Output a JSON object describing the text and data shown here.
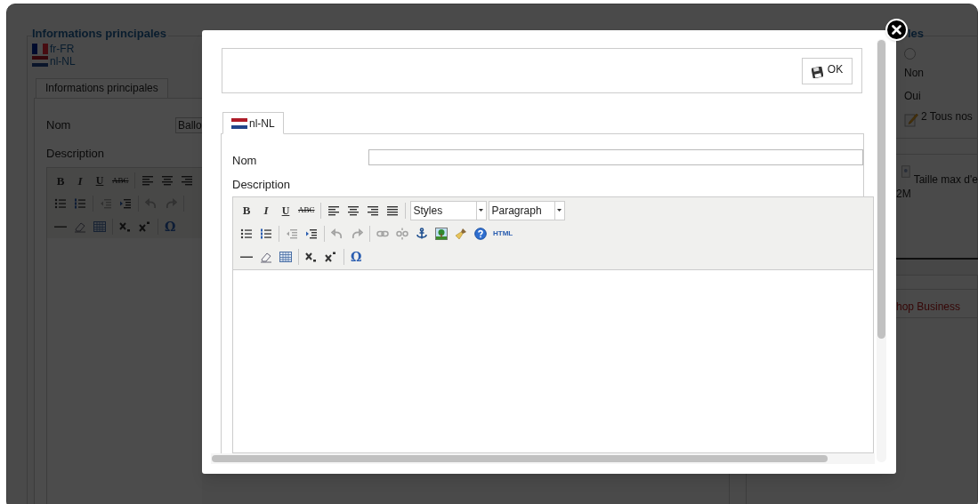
{
  "background_page": {
    "left_panel": {
      "heading": "Informations principales",
      "languages": [
        {
          "kind": "fr",
          "label": "fr-FR"
        },
        {
          "kind": "nl",
          "label": "nl-NL"
        }
      ],
      "tabs": [
        {
          "label": "Informations principales",
          "selected": true
        }
      ],
      "name_label": "Nom",
      "name_value": "Ballo",
      "description_label": "Description",
      "toolbar_rows": [
        [
          {
            "kind": "bold",
            "text": "B",
            "disabled": false
          },
          {
            "kind": "italic",
            "text": "I",
            "disabled": false
          },
          {
            "kind": "underline",
            "text": "U",
            "disabled": false
          },
          {
            "kind": "strike",
            "text": "ABC",
            "disabled": false
          },
          {
            "kind": "separator"
          },
          {
            "kind": "align-left",
            "disabled": false
          },
          {
            "kind": "align-center",
            "disabled": false
          },
          {
            "kind": "align-right",
            "disabled": false
          }
        ],
        [
          {
            "kind": "bullet-list",
            "disabled": false
          },
          {
            "kind": "number-list",
            "disabled": false
          },
          {
            "kind": "separator"
          },
          {
            "kind": "outdent",
            "disabled": true
          },
          {
            "kind": "indent",
            "disabled": false
          },
          {
            "kind": "separator"
          },
          {
            "kind": "undo",
            "disabled": true
          },
          {
            "kind": "redo",
            "disabled": true
          },
          {
            "kind": "separator"
          }
        ],
        [
          {
            "kind": "hr",
            "disabled": false
          },
          {
            "kind": "eraser",
            "disabled": false
          },
          {
            "kind": "table",
            "disabled": false
          },
          {
            "kind": "separator"
          },
          {
            "kind": "subscript",
            "disabled": false
          },
          {
            "kind": "superscript",
            "disabled": false
          },
          {
            "kind": "separator"
          },
          {
            "kind": "omega",
            "text": "Ω",
            "disabled": false
          }
        ]
      ]
    },
    "right_panel": {
      "heading": "les",
      "radio_checked": false,
      "options": [
        "Non",
        "Oui"
      ],
      "category_text": "2 Tous nos",
      "upload_text": "Taille max d'e",
      "upload_size": "2M",
      "link_text": "hop Business"
    }
  },
  "modal": {
    "ok_button": "OK",
    "tabs": [
      {
        "kind": "nl",
        "label": "nl-NL",
        "selected": true
      }
    ],
    "name_label": "Nom",
    "description_label": "Description",
    "styles_select": "Styles",
    "format_select": "Paragraph",
    "toolbar_rows": [
      [
        {
          "kind": "bold",
          "text": "B",
          "disabled": false
        },
        {
          "kind": "italic",
          "text": "I",
          "disabled": false
        },
        {
          "kind": "underline",
          "text": "U",
          "disabled": false
        },
        {
          "kind": "strike",
          "text": "ABC",
          "disabled": false
        },
        {
          "kind": "separator"
        },
        {
          "kind": "align-left",
          "disabled": false
        },
        {
          "kind": "align-center",
          "disabled": false
        },
        {
          "kind": "align-right",
          "disabled": false
        },
        {
          "kind": "justify",
          "disabled": false
        },
        {
          "kind": "separator"
        },
        {
          "kind": "styles-select"
        },
        {
          "kind": "format-select"
        }
      ],
      [
        {
          "kind": "bullet-list",
          "disabled": false
        },
        {
          "kind": "number-list",
          "disabled": false
        },
        {
          "kind": "separator"
        },
        {
          "kind": "outdent",
          "disabled": true
        },
        {
          "kind": "indent",
          "disabled": false
        },
        {
          "kind": "separator"
        },
        {
          "kind": "undo",
          "disabled": true
        },
        {
          "kind": "redo",
          "disabled": true
        },
        {
          "kind": "separator"
        },
        {
          "kind": "link",
          "disabled": true
        },
        {
          "kind": "unlink",
          "disabled": true
        },
        {
          "kind": "anchor",
          "disabled": false
        },
        {
          "kind": "image",
          "disabled": false
        },
        {
          "kind": "cleanup",
          "disabled": false
        },
        {
          "kind": "help",
          "disabled": false
        },
        {
          "kind": "html",
          "text": "HTML",
          "disabled": false
        }
      ],
      [
        {
          "kind": "hr",
          "disabled": false
        },
        {
          "kind": "eraser",
          "disabled": false
        },
        {
          "kind": "table",
          "disabled": false
        },
        {
          "kind": "separator"
        },
        {
          "kind": "subscript",
          "disabled": false
        },
        {
          "kind": "superscript",
          "disabled": false
        },
        {
          "kind": "separator"
        },
        {
          "kind": "omega",
          "text": "Ω",
          "disabled": false
        }
      ]
    ]
  }
}
